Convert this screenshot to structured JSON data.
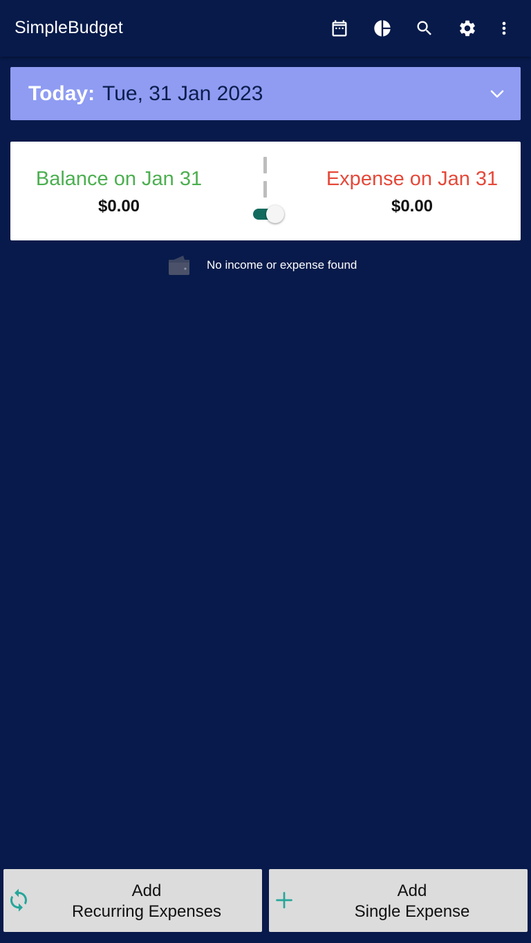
{
  "app": {
    "title": "SimpleBudget"
  },
  "toolbar": {
    "icons": [
      "calendar-icon",
      "pie-chart-icon",
      "search-icon",
      "settings-icon",
      "more-vert-icon"
    ]
  },
  "date_bar": {
    "label": "Today:",
    "value": "Tue, 31 Jan 2023"
  },
  "summary": {
    "balance_label": "Balance on Jan 31",
    "balance_amount": "$0.00",
    "expense_label": "Expense on Jan 31",
    "expense_amount": "$0.00",
    "toggle_on": true
  },
  "empty_state": {
    "message": "No income or expense found"
  },
  "actions": {
    "recurring": {
      "line1": "Add",
      "line2": "Recurring Expenses"
    },
    "single": {
      "line1": "Add",
      "line2": "Single Expense"
    }
  },
  "colors": {
    "background": "#081a4b",
    "date_bar": "#8f9cf2",
    "balance": "#4caf50",
    "expense": "#e5493a",
    "accent": "#26a69a",
    "toggle_track": "#136b5e"
  }
}
